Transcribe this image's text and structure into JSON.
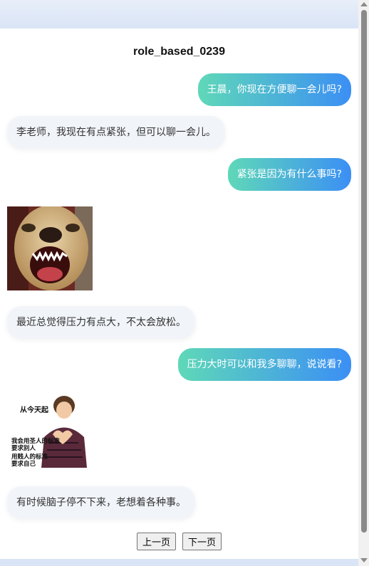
{
  "title": "role_based_0239",
  "messages": [
    {
      "side": "me",
      "text": "王晨，你现在方便聊一会儿吗?"
    },
    {
      "side": "other",
      "text": "李老师，我现在有点紧张，但可以聊一会儿。"
    },
    {
      "side": "me",
      "text": "紧张是因为有什么事吗?"
    },
    {
      "side": "other",
      "image": "angry-dog-meme"
    },
    {
      "side": "other",
      "text": "最近总觉得压力有点大，不太会放松。"
    },
    {
      "side": "me",
      "text": "压力大时可以和我多聊聊，说说看?"
    },
    {
      "side": "other",
      "image": "heart-hands-meme",
      "caption": [
        "从今天起",
        "我会用圣人的标准",
        "要求别人",
        "用贱人的标准",
        "要求自己"
      ]
    },
    {
      "side": "other",
      "text": "有时候脑子停不下来，老想着各种事。"
    }
  ],
  "pager": {
    "prev": "上一页",
    "next": "下一页"
  },
  "colors": {
    "me_gradient_start": "#5fd8b8",
    "me_gradient_end": "#3b8ff5",
    "other_bg": "#f1f4f9"
  }
}
